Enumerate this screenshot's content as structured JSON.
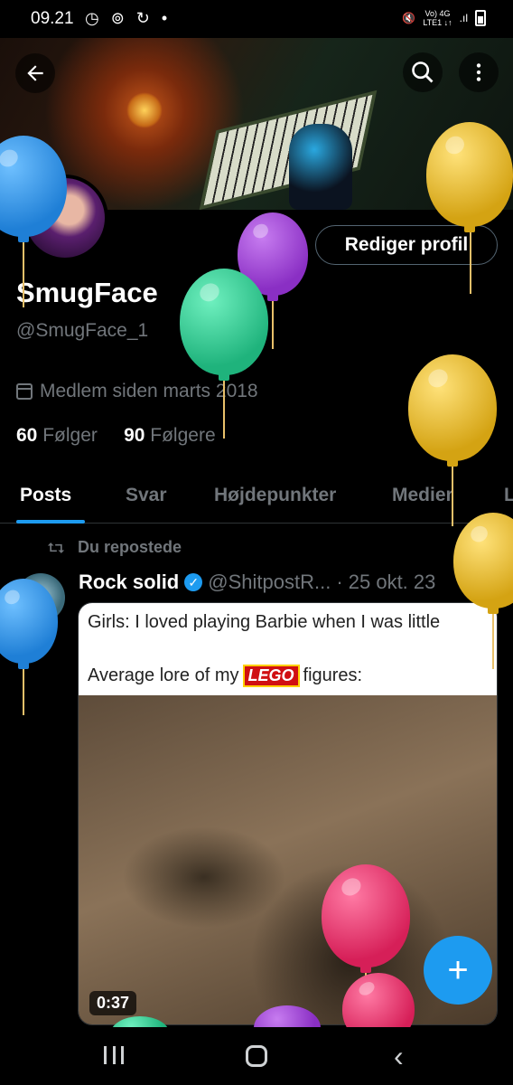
{
  "status_bar": {
    "time": "09.21",
    "left_icons": "◷ ⊚ ↻ •",
    "network_top": "Vo) 4G",
    "network_bottom": "LTE1 ↓↑",
    "signal": ".ıl"
  },
  "header": {
    "back_icon": "arrow-left-icon",
    "search_icon": "search-icon",
    "more_icon": "more-vertical-icon"
  },
  "profile": {
    "edit_label": "Rediger profil",
    "display_name": "SmugFace",
    "handle": "@SmugFace_1",
    "joined": "Medlem siden marts 2018",
    "following_count": "60",
    "following_label": "Følger",
    "followers_count": "90",
    "followers_label": "Følgere"
  },
  "tabs": [
    {
      "label": "Posts",
      "active": true
    },
    {
      "label": "Svar",
      "active": false
    },
    {
      "label": "Højdepunkter",
      "active": false
    },
    {
      "label": "Medier",
      "active": false
    },
    {
      "label": "L",
      "active": false
    }
  ],
  "post": {
    "repost_label": "Du repostede",
    "author_name": "Rock solid",
    "author_handle": "@ShitpostR...",
    "date": "· 25 okt. 23",
    "meme_line1": "Girls: I loved playing Barbie when I was little",
    "meme_line2_pre": "Average lore of my",
    "meme_logo": "LEGO",
    "meme_line2_post": "figures:",
    "video_duration": "0:37"
  },
  "fab_label": "+",
  "nav": {
    "back_glyph": "‹"
  },
  "colors": {
    "accent": "#1d9bf0",
    "muted": "#71767b",
    "background": "#000000",
    "balloon_blue": "#2a8fe0",
    "balloon_purple": "#9b3fd0",
    "balloon_green": "#26c48a",
    "balloon_yellow": "#e2b322",
    "balloon_pink": "#e0306a"
  }
}
